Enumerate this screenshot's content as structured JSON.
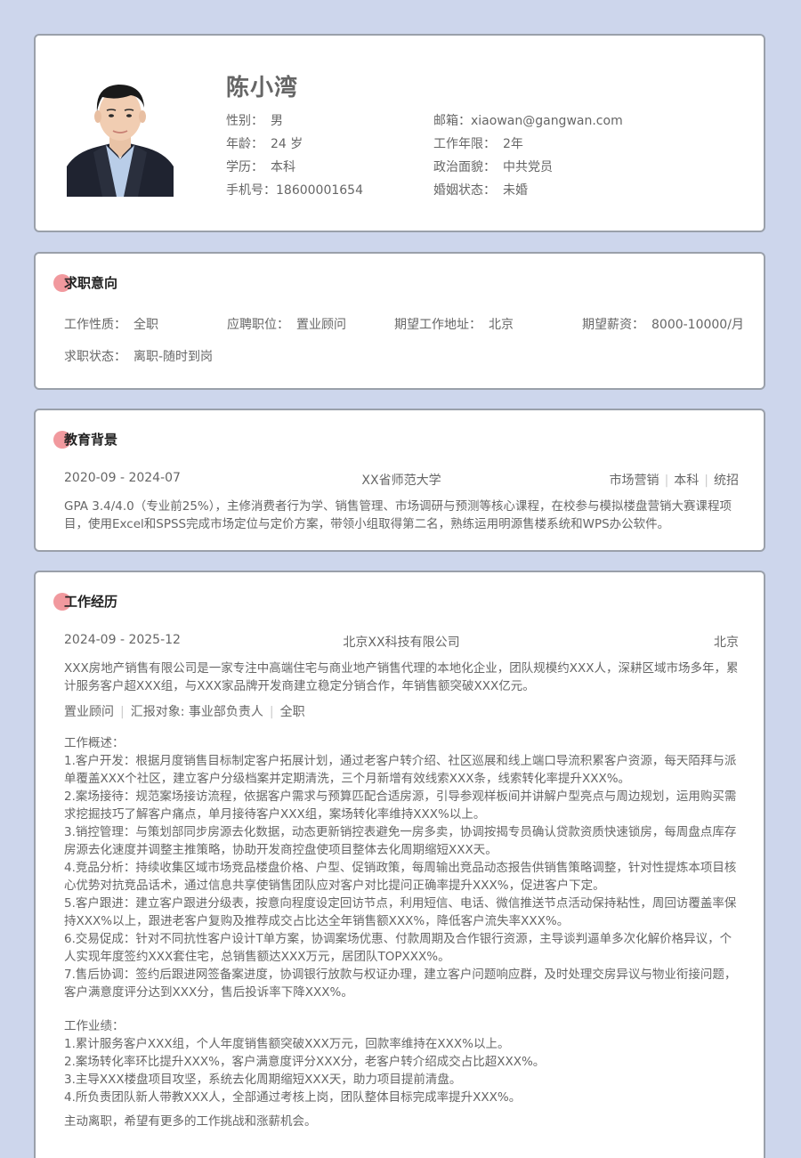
{
  "profile": {
    "name": "陈小湾",
    "gender_label": "性别：",
    "gender": "男",
    "age_label": "年龄：",
    "age": "24 岁",
    "education_label": "学历：",
    "education": "本科",
    "phone_label": "手机号：",
    "phone": "18600001654",
    "email_label": "邮箱：",
    "email": "xiaowan@gangwan.com",
    "years_label": "工作年限：",
    "years": "2年",
    "political_label": "政治面貌：",
    "political": "中共党员",
    "marital_label": "婚姻状态：",
    "marital": "未婚"
  },
  "intent": {
    "title": "求职意向",
    "type_label": "工作性质：",
    "type": "全职",
    "position_label": "应聘职位：",
    "position": "置业顾问",
    "location_label": "期望工作地址：",
    "location": "北京",
    "salary_label": "期望薪资：",
    "salary": "8000-10000/月",
    "status_label": "求职状态：",
    "status": "离职-随时到岗"
  },
  "education": {
    "title": "教育背景",
    "period": "2020-09 - 2024-07",
    "school": "XX省师范大学",
    "major": "市场营销",
    "degree": "本科",
    "enroll": "统招",
    "desc": "GPA 3.4/4.0（专业前25%），主修消费者行为学、销售管理、市场调研与预测等核心课程，在校参与模拟楼盘营销大赛课程项目，使用Excel和SPSS完成市场定位与定价方案，带领小组取得第二名，熟练运用明源售楼系统和WPS办公软件。"
  },
  "work": {
    "title": "工作经历",
    "period": "2024-09 - 2025-12",
    "company": "北京XX科技有限公司",
    "city": "北京",
    "company_desc": "XXX房地产销售有限公司是一家专注中高端住宅与商业地产销售代理的本地化企业，团队规模约XXX人，深耕区域市场多年，累计服务客户超XXX组，与XXX家品牌开发商建立稳定分销合作，年销售额突破XXX亿元。",
    "role": "置业顾问",
    "report_to": "汇报对象: 事业部负责人",
    "job_type": "全职",
    "overview_title": "工作概述：",
    "overview": [
      "1.客户开发：根据月度销售目标制定客户拓展计划，通过老客户转介绍、社区巡展和线上端口导流积累客户资源，每天陌拜与派单覆盖XXX个社区，建立客户分级档案并定期清洗，三个月新增有效线索XXX条，线索转化率提升XXX%。",
      "2.案场接待：规范案场接访流程，依据客户需求与预算匹配合适房源，引导参观样板间并讲解户型亮点与周边规划，运用购买需求挖掘技巧了解客户痛点，单月接待客户XXX组，案场转化率维持XXX%以上。",
      "3.销控管理：与策划部同步房源去化数据，动态更新销控表避免一房多卖，协调按揭专员确认贷款资质快速锁房，每周盘点库存房源去化速度并调整主推策略，协助开发商控盘使项目整体去化周期缩短XXX天。",
      "4.竞品分析：持续收集区域市场竞品楼盘价格、户型、促销政策，每周输出竞品动态报告供销售策略调整，针对性提炼本项目核心优势对抗竞品话术，通过信息共享使销售团队应对客户对比提问正确率提升XXX%，促进客户下定。",
      "5.客户跟进：建立客户跟进分级表，按意向程度设定回访节点，利用短信、电话、微信推送节点活动保持粘性，周回访覆盖率保持XXX%以上，跟进老客户复购及推荐成交占比达全年销售额XXX%，降低客户流失率XXX%。",
      "6.交易促成：针对不同抗性客户设计T单方案，协调案场优惠、付款周期及合作银行资源，主导谈判逼单多次化解价格异议，个人实现年度签约XXX套住宅，总销售额达XXX万元，居团队TOPXXX%。",
      "7.售后协调：签约后跟进网签备案进度，协调银行放款与权证办理，建立客户问题响应群，及时处理交房异议与物业衔接问题，客户满意度评分达到XXX分，售后投诉率下降XXX%。"
    ],
    "achievements_title": "工作业绩：",
    "achievements": [
      "1.累计服务客户XXX组，个人年度销售额突破XXX万元，回款率维持在XXX%以上。",
      "2.案场转化率环比提升XXX%，客户满意度评分XXX分，老客户转介绍成交占比超XXX%。",
      "3.主导XXX楼盘项目攻坚，系统去化周期缩短XXX天，助力项目提前清盘。",
      "4.所负责团队新人带教XXX人，全部通过考核上岗，团队整体目标完成率提升XXX%。"
    ],
    "leave_reason": "主动离职，希望有更多的工作挑战和涨薪机会。"
  }
}
